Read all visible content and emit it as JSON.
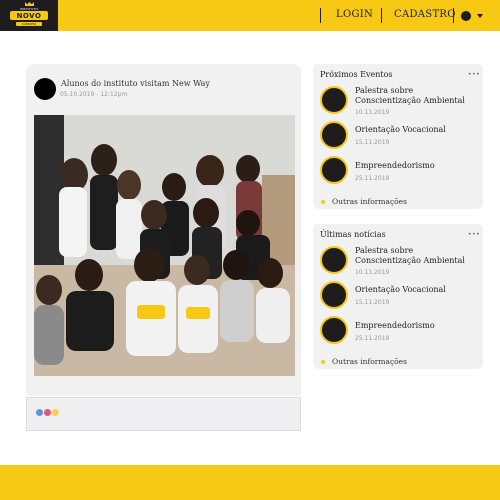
{
  "header": {
    "logo": {
      "small_text": "INSTITUTO",
      "word": "NOVO",
      "tagline": "CAMINHO"
    },
    "nav": {
      "login": "LOGIN",
      "signup": "CADASTRO"
    },
    "brand_color": "#f7c814",
    "dark_color": "#1d1d1d"
  },
  "post": {
    "title": "Alunos do instituto visitam New Way",
    "date": "05.10.2019 - 12:12pm",
    "reactions": [
      {
        "name": "like",
        "color": "#6a8fe0"
      },
      {
        "name": "love",
        "color": "#e5576a"
      },
      {
        "name": "haha",
        "color": "#f4d15a"
      }
    ]
  },
  "events": {
    "title": "Próximos Eventos",
    "menu": "•••",
    "items": [
      {
        "title": "Palestra sobre Conscientização Ambiental",
        "date": "10.11.2019"
      },
      {
        "title": "Orientação Vocacional",
        "date": "15.11.2019"
      },
      {
        "title": "Empreendedorismo",
        "date": "25.11.2019"
      }
    ],
    "more": "Outras informações"
  },
  "news": {
    "title": "Últimas notícias",
    "menu": "•••",
    "items": [
      {
        "title": "Palestra sobre Conscientização Ambiental",
        "date": "10.11.2019"
      },
      {
        "title": "Orientação Vocacional",
        "date": "15.11.2019"
      },
      {
        "title": "Empreendedorismo",
        "date": "25.11.2019"
      }
    ],
    "more": "Outras informações"
  }
}
